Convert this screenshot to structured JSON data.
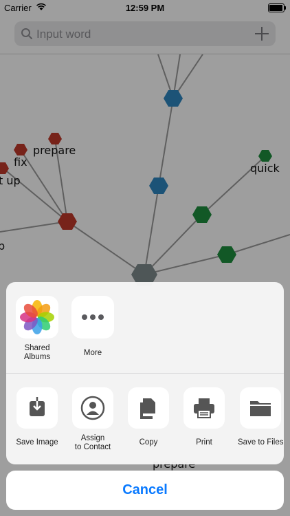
{
  "status_bar": {
    "carrier": "Carrier",
    "time": "12:59 PM"
  },
  "search": {
    "placeholder": "Input word"
  },
  "graph": {
    "labels": {
      "prepare_top": "prepare",
      "fix": "fix",
      "cut_up": "t up",
      "quick": "quick",
      "p_left": "p",
      "prepare_bottom": "prepare"
    },
    "colors": {
      "red": "#c0392b",
      "blue": "#2e86c1",
      "green": "#1e8e3e",
      "gray": "#7f8c8d"
    }
  },
  "share_sheet": {
    "apps": [
      {
        "label": "Shared Albums",
        "icon": "photos-icon"
      },
      {
        "label": "More",
        "icon": "more-icon"
      }
    ],
    "actions": [
      {
        "label": "Save Image",
        "icon": "save-image-icon"
      },
      {
        "label": "Assign to Contact",
        "icon": "contact-icon"
      },
      {
        "label": "Copy",
        "icon": "copy-icon"
      },
      {
        "label": "Print",
        "icon": "print-icon"
      },
      {
        "label": "Save to Files",
        "icon": "folder-icon"
      }
    ],
    "cancel_label": "Cancel"
  },
  "colors": {
    "accent": "#0a7aff"
  }
}
